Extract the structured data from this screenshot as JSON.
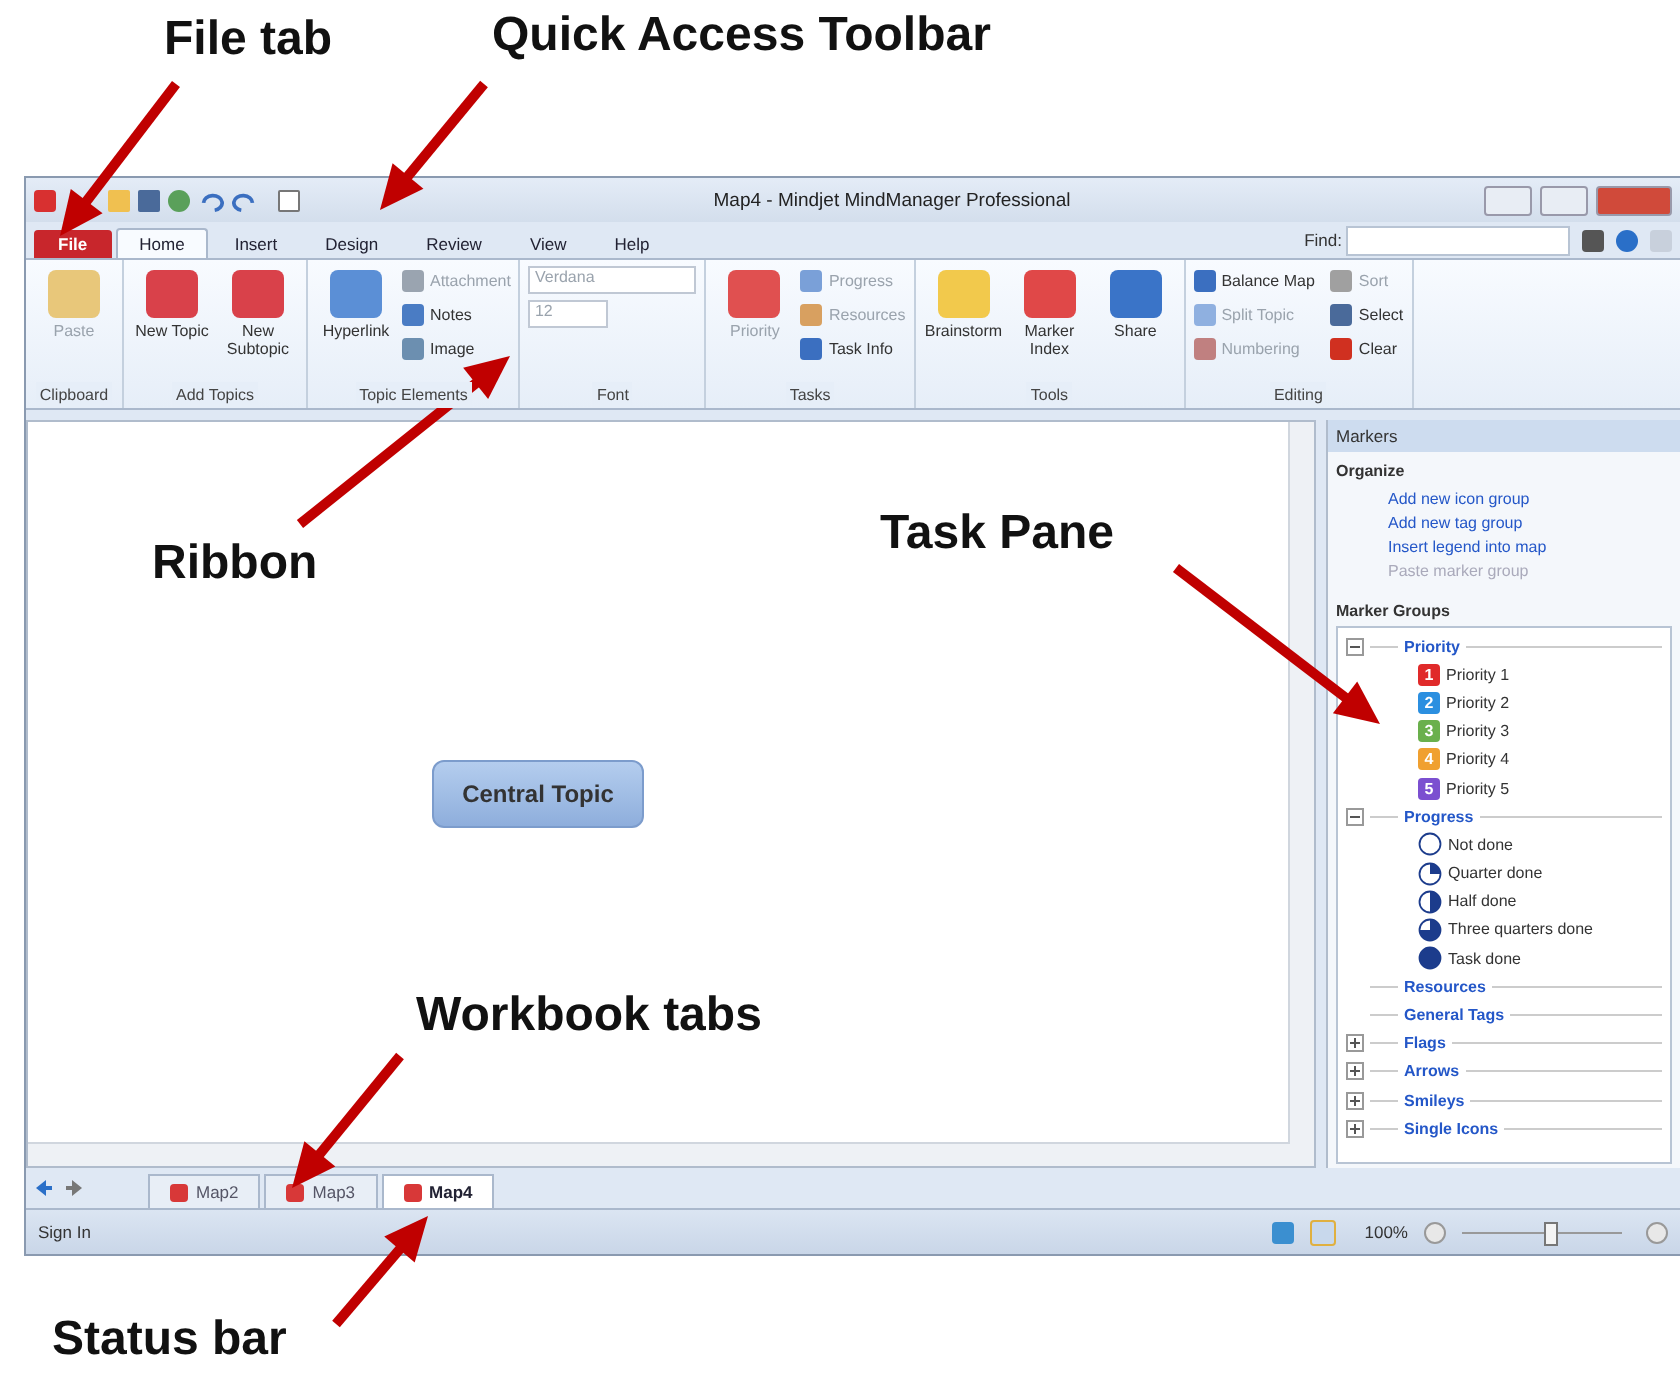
{
  "callouts": [
    {
      "text": "File tab"
    },
    {
      "text": "Quick Access Toolbar"
    },
    {
      "text": "Ribbon"
    },
    {
      "text": "Task Pane"
    },
    {
      "text": "Workbook tabs"
    },
    {
      "text": "Status bar"
    }
  ],
  "window": {
    "title": "Map4 - Mindjet MindManager Professional"
  },
  "ribbon_tabs": [
    {
      "label": "File",
      "kind": "file",
      "selected": false
    },
    {
      "label": "Home",
      "kind": "tab",
      "selected": true
    },
    {
      "label": "Insert",
      "kind": "tab",
      "selected": false
    },
    {
      "label": "Design",
      "kind": "tab",
      "selected": false
    },
    {
      "label": "Review",
      "kind": "tab",
      "selected": false
    },
    {
      "label": "View",
      "kind": "tab",
      "selected": false
    },
    {
      "label": "Help",
      "kind": "tab",
      "selected": false
    }
  ],
  "find": {
    "label": "Find:"
  },
  "ribbon_groups": [
    {
      "label": "Clipboard",
      "commands": [
        {
          "label": "Paste",
          "kind": "large",
          "disabled": true,
          "color": "#e8c77a"
        }
      ]
    },
    {
      "label": "Add Topics",
      "commands": [
        {
          "label": "New Topic",
          "kind": "large",
          "disabled": false,
          "color": "#d9414a"
        },
        {
          "label": "New Subtopic",
          "kind": "large",
          "disabled": false,
          "color": "#d9414a"
        }
      ]
    },
    {
      "label": "Topic Elements",
      "commands": [
        {
          "label": "Hyperlink",
          "kind": "large",
          "disabled": false,
          "color": "#5b8fd6"
        },
        {
          "label": "Attachment",
          "kind": "small",
          "disabled": true,
          "color": "#9aa4b0"
        },
        {
          "label": "Notes",
          "kind": "small",
          "disabled": false,
          "color": "#4a7cc4"
        },
        {
          "label": "Image",
          "kind": "small",
          "disabled": false,
          "color": "#6c8fb0"
        }
      ]
    },
    {
      "label": "Font",
      "commands": [
        {
          "label": "Verdana",
          "kind": "field",
          "disabled": true,
          "color": "#ffffff"
        },
        {
          "label": "12",
          "kind": "field",
          "disabled": true,
          "color": "#ffffff"
        }
      ]
    },
    {
      "label": "Tasks",
      "commands": [
        {
          "label": "Priority",
          "kind": "large",
          "disabled": true,
          "color": "#e05050"
        },
        {
          "label": "Progress",
          "kind": "small",
          "disabled": true,
          "color": "#7aa0d8"
        },
        {
          "label": "Resources",
          "kind": "small",
          "disabled": true,
          "color": "#d8a060"
        },
        {
          "label": "Task Info",
          "kind": "small",
          "disabled": false,
          "color": "#3b6fc0"
        }
      ]
    },
    {
      "label": "Tools",
      "commands": [
        {
          "label": "Brainstorm",
          "kind": "large",
          "disabled": false,
          "color": "#f2c94c"
        },
        {
          "label": "Marker Index",
          "kind": "large",
          "disabled": false,
          "color": "#e04848"
        },
        {
          "label": "Share",
          "kind": "large",
          "disabled": false,
          "color": "#3a74c8"
        }
      ]
    },
    {
      "label": "Editing",
      "commands": [
        {
          "label": "Balance Map",
          "kind": "small",
          "disabled": false,
          "color": "#3b6fc0"
        },
        {
          "label": "Split Topic",
          "kind": "small",
          "disabled": true,
          "color": "#8fb0e0"
        },
        {
          "label": "Numbering",
          "kind": "small",
          "disabled": true,
          "color": "#c08080"
        },
        {
          "label": "Sort",
          "kind": "small",
          "disabled": true,
          "color": "#a0a0a0"
        },
        {
          "label": "Select",
          "kind": "small",
          "disabled": false,
          "color": "#4a6a9a"
        },
        {
          "label": "Clear",
          "kind": "small",
          "disabled": false,
          "color": "#d03020"
        }
      ]
    }
  ],
  "canvas": {
    "central_topic": "Central Topic"
  },
  "task_pane": {
    "title": "Markers",
    "organize": {
      "heading": "Organize",
      "links": [
        {
          "label": "Add new icon group",
          "disabled": false
        },
        {
          "label": "Add new tag group",
          "disabled": false
        },
        {
          "label": "Insert legend into map",
          "disabled": false
        },
        {
          "label": "Paste marker group",
          "disabled": true
        }
      ]
    },
    "marker_groups": {
      "heading": "Marker Groups",
      "groups": [
        {
          "label": "Priority",
          "expanded": true,
          "children": [
            {
              "label": "Priority 1",
              "badge": "1",
              "color": "#e02a2a"
            },
            {
              "label": "Priority 2",
              "badge": "2",
              "color": "#2b8fe0"
            },
            {
              "label": "Priority 3",
              "badge": "3",
              "color": "#6ab04c"
            },
            {
              "label": "Priority 4",
              "badge": "4",
              "color": "#f0a030"
            },
            {
              "label": "Priority 5",
              "badge": "5",
              "color": "#7b4fd0"
            }
          ]
        },
        {
          "label": "Progress",
          "expanded": true,
          "children": [
            {
              "label": "Not done",
              "kind": "none"
            },
            {
              "label": "Quarter done",
              "kind": "quarter"
            },
            {
              "label": "Half done",
              "kind": "half"
            },
            {
              "label": "Three quarters done",
              "kind": "three_quarters"
            },
            {
              "label": "Task done",
              "kind": "done"
            }
          ]
        },
        {
          "label": "Resources"
        },
        {
          "label": "General Tags"
        },
        {
          "label": "Flags",
          "expanded": false
        },
        {
          "label": "Arrows",
          "expanded": false
        },
        {
          "label": "Smileys",
          "expanded": false
        },
        {
          "label": "Single Icons",
          "expanded": false
        }
      ]
    }
  },
  "workbook_tabs": [
    {
      "label": "Map2",
      "selected": false
    },
    {
      "label": "Map3",
      "selected": false
    },
    {
      "label": "Map4",
      "selected": true
    }
  ],
  "status_bar": {
    "sign_in": "Sign In",
    "zoom": "100%",
    "zoom_slider": {
      "level": 0.55
    }
  }
}
